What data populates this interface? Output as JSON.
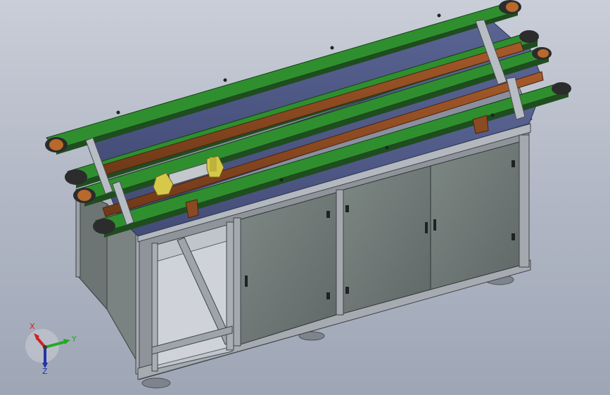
{
  "viewport": {
    "background_top": "#c9ced8",
    "background_bottom": "#9ea6b6"
  },
  "model": {
    "frame_color": "#8f959c",
    "panel_color": "#707a78",
    "belt_green": "#2f8f2f",
    "belt_blue": "#505a86",
    "wood_color": "#8a4a22",
    "roller_end": "#b86a2c",
    "fixture_yellow": "#d6c94a"
  },
  "triad": {
    "x_label": "X",
    "y_label": "Y",
    "z_label": "Z",
    "x_color": "#cc2222",
    "y_color": "#22aa22",
    "z_color": "#2233aa"
  }
}
